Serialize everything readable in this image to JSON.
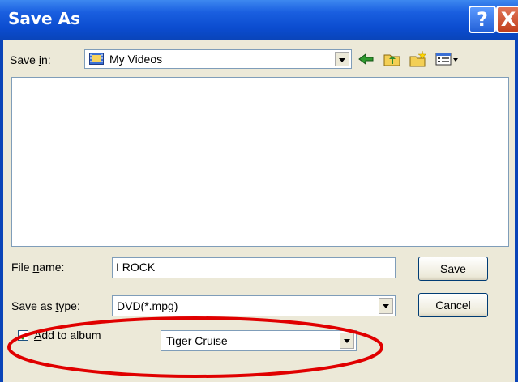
{
  "window": {
    "title": "Save As",
    "help_glyph": "?",
    "close_glyph": "X"
  },
  "save_in": {
    "label_pre": "Save ",
    "label_u": "i",
    "label_post": "n:",
    "value": "My Videos"
  },
  "toolbar": {
    "icons": [
      "back-arrow-icon",
      "up-folder-icon",
      "new-folder-icon",
      "views-menu-icon"
    ]
  },
  "file_name": {
    "label_pre": "File ",
    "label_u": "n",
    "label_post": "ame:",
    "value": "I ROCK"
  },
  "save_as_type": {
    "label_pre": "Save as ",
    "label_u": "t",
    "label_post": "ype:",
    "value": "DVD(*.mpg)"
  },
  "buttons": {
    "save_u": "S",
    "save_rest": "ave",
    "cancel": "Cancel"
  },
  "album": {
    "checked": true,
    "label_u": "A",
    "label_rest": "dd to album",
    "value": "Tiger Cruise"
  },
  "colors": {
    "title_bar": "#0a44b8",
    "dialog_bg": "#ece9d8",
    "highlight_oval": "#e00000"
  }
}
